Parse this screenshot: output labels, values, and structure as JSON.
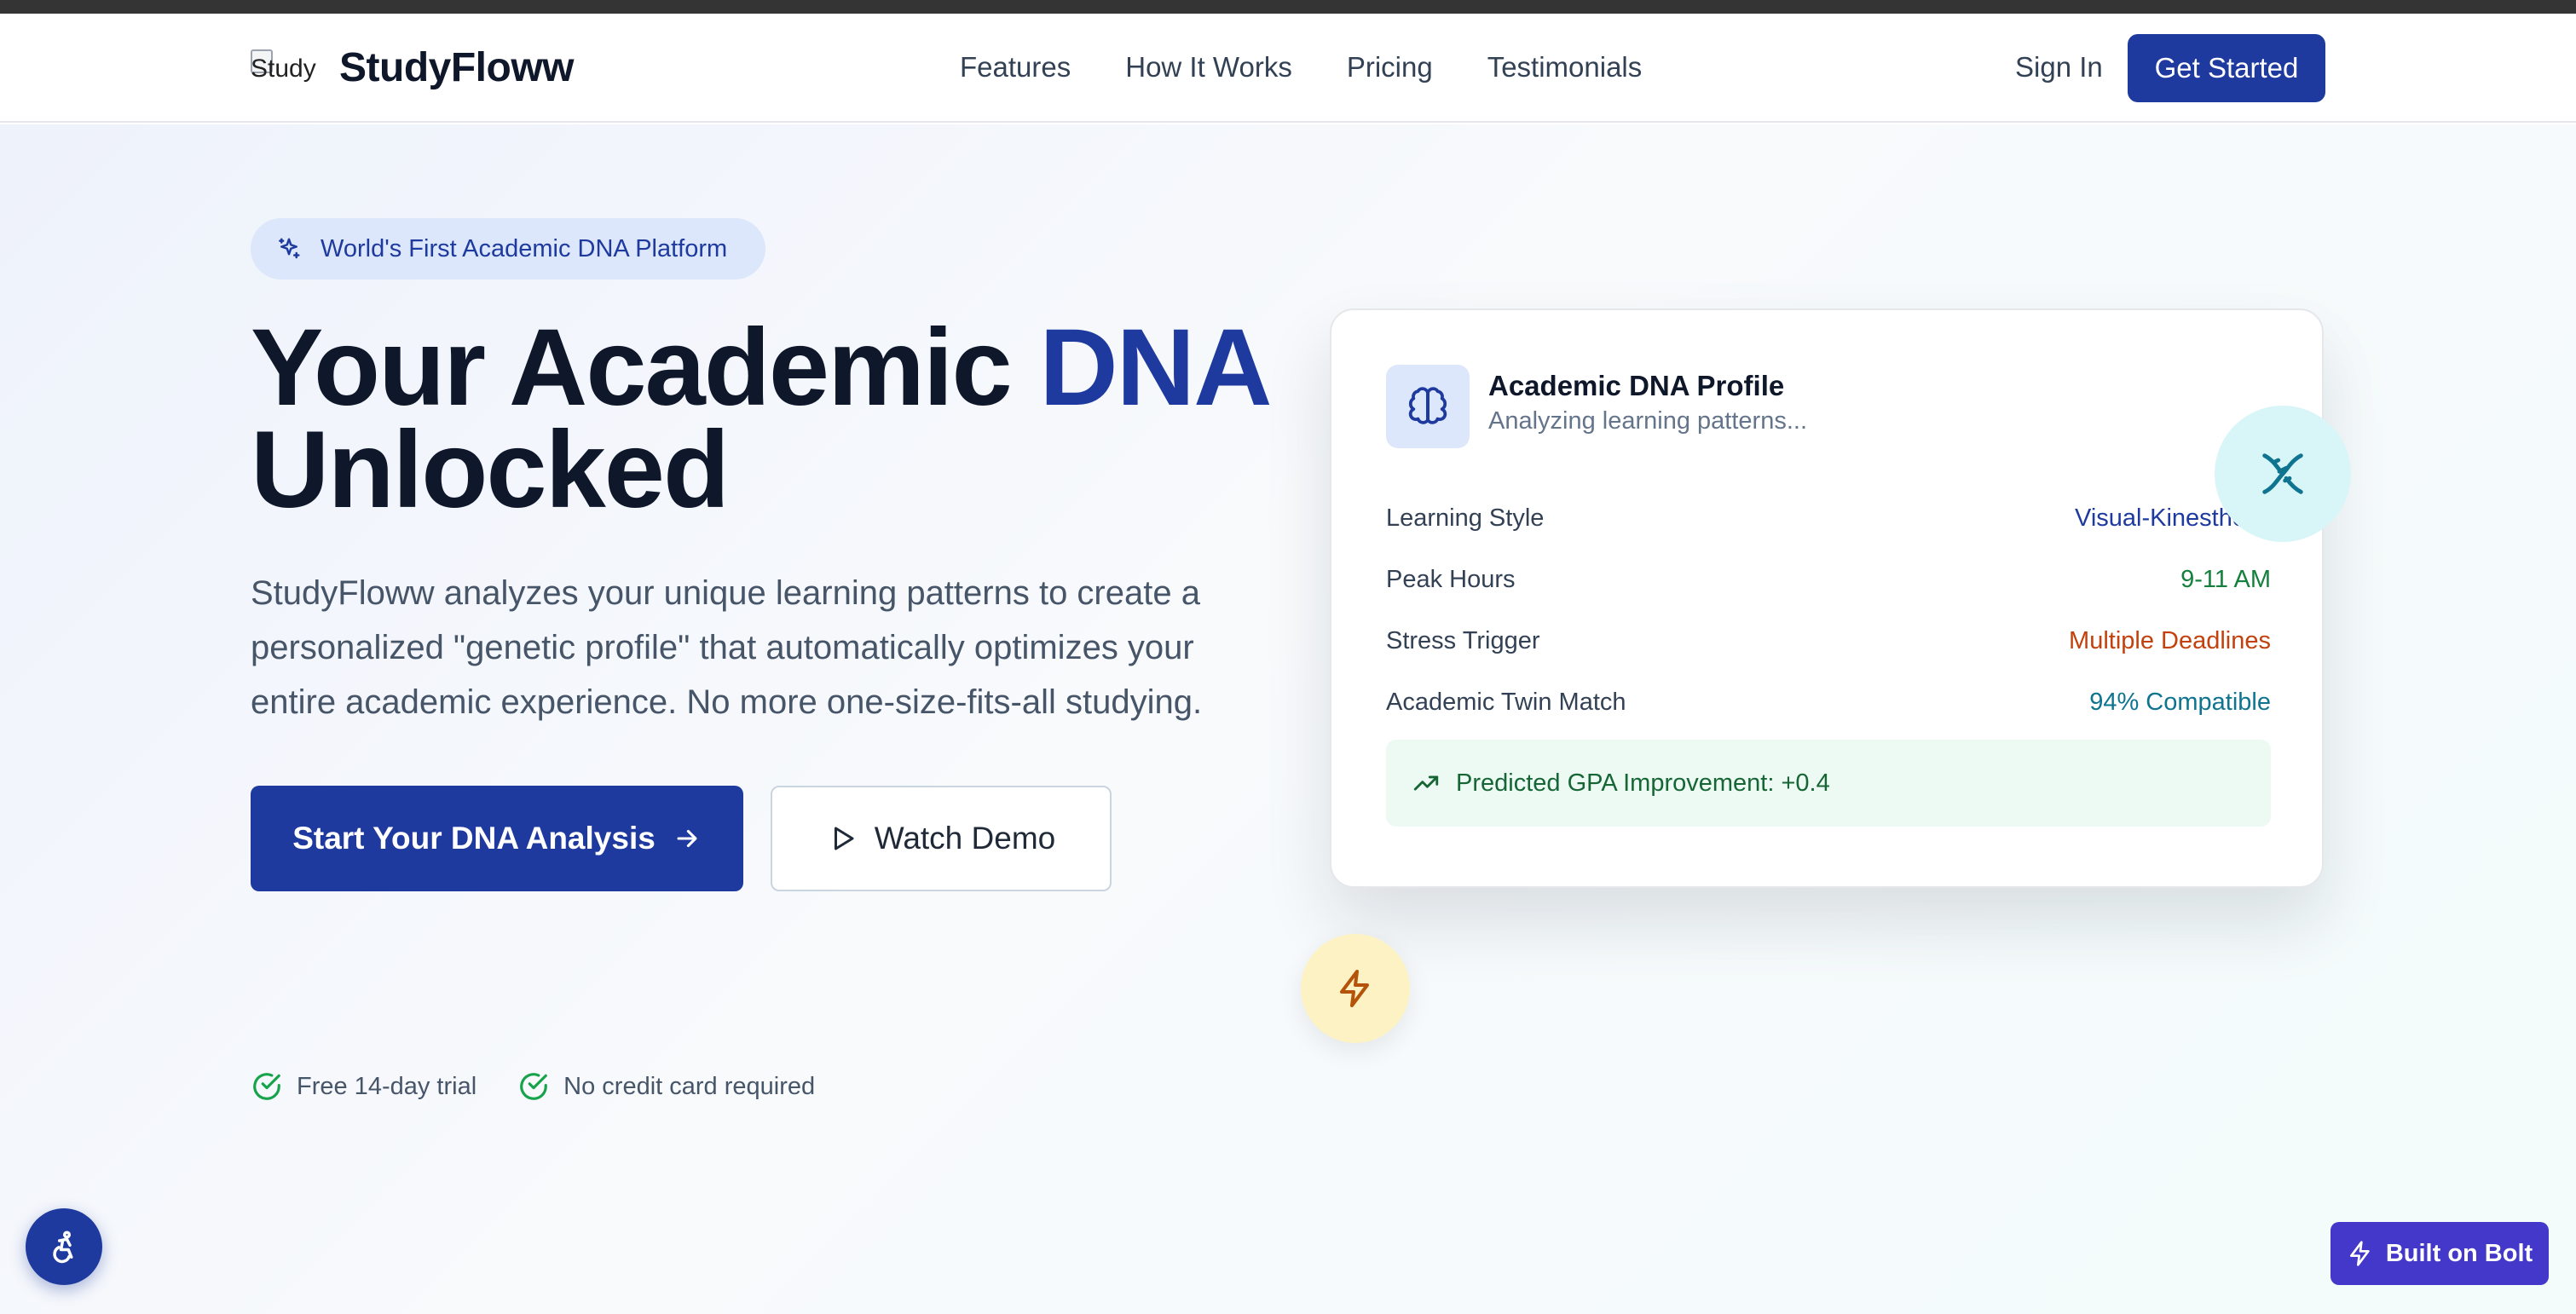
{
  "nav": {
    "logo_alt": "Study",
    "brand": "StudyFloww",
    "links": [
      "Features",
      "How It Works",
      "Pricing",
      "Testimonials"
    ],
    "sign_in": "Sign In",
    "get_started": "Get Started"
  },
  "hero": {
    "badge": "World's First Academic DNA Platform",
    "title_part1": "Your Academic ",
    "title_accent": "DNA",
    "title_part2": "Unlocked",
    "description": "StudyFloww analyzes your unique learning patterns to create a personalized \"genetic profile\" that automatically optimizes your entire academic experience. No more one-size-fits-all studying.",
    "primary_cta": "Start Your DNA Analysis",
    "secondary_cta": "Watch Demo",
    "perks": [
      "Free 14-day trial",
      "No credit card required"
    ]
  },
  "profile_card": {
    "title": "Academic DNA Profile",
    "subtitle": "Analyzing learning patterns...",
    "metrics": [
      {
        "label": "Learning Style",
        "value": "Visual-Kinesthetic",
        "color": "#1e3a9f"
      },
      {
        "label": "Peak Hours",
        "value": "9-11 AM",
        "color": "#15803d"
      },
      {
        "label": "Stress Trigger",
        "value": "Multiple Deadlines",
        "color": "#c2410c"
      },
      {
        "label": "Academic Twin Match",
        "value": "94% Compatible",
        "color": "#0e7490"
      }
    ],
    "prediction": "Predicted GPA Improvement: +0.4"
  },
  "floating": {
    "built_on": "Built on Bolt"
  },
  "icons": [
    "sparkles-icon",
    "arrow-right-icon",
    "play-icon",
    "check-circle-icon",
    "brain-icon",
    "trending-up-icon",
    "dna-icon",
    "zap-icon",
    "accessibility-icon"
  ],
  "colors": {
    "brand": "#1e3a9f",
    "bolt_button": "#4338ca"
  }
}
